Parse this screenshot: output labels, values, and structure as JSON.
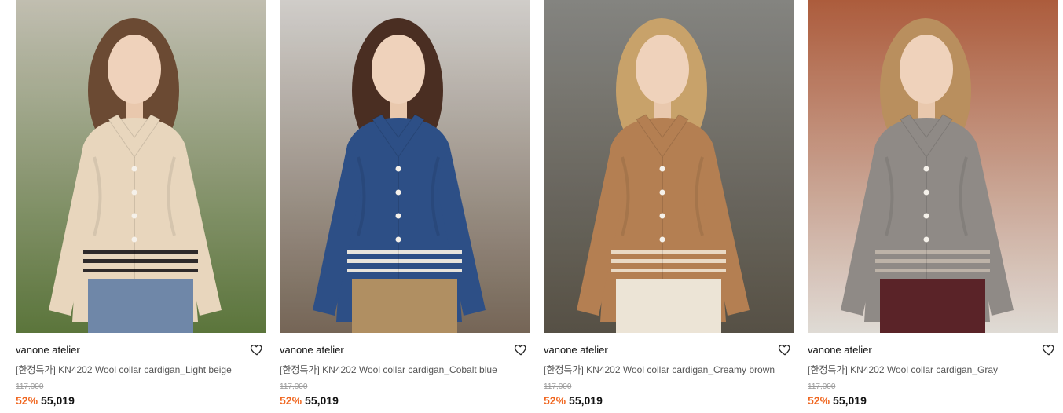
{
  "products": [
    {
      "brand": "vanone atelier",
      "title": "[한정특가] KN4202 Wool collar cardigan_Light beige",
      "original_price": "117,000",
      "discount": "52%",
      "price": "55,019",
      "wishlist_icon": "heart-outline-icon",
      "colors": {
        "bg_top": "#c9c6b8",
        "bg_bottom": "#5f7a3e",
        "garment": "#e8d6bd",
        "stripe": "#2e2a2a",
        "hair": "#6b4a33",
        "pants": "#6f87a8"
      }
    },
    {
      "brand": "vanone atelier",
      "title": "[한정특가] KN4202 Wool collar cardigan_Cobalt blue",
      "original_price": "117,000",
      "discount": "52%",
      "price": "55,019",
      "wishlist_icon": "heart-outline-icon",
      "colors": {
        "bg_top": "#d9d6d2",
        "bg_bottom": "#7a6a5a",
        "garment": "#2d4f86",
        "stripe": "#e8e4dc",
        "hair": "#4a2e22",
        "pants": "#b08f62"
      }
    },
    {
      "brand": "vanone atelier",
      "title": "[한정특가] KN4202 Wool collar cardigan_Creamy brown",
      "original_price": "117,000",
      "discount": "52%",
      "price": "55,019",
      "wishlist_icon": "heart-outline-icon",
      "colors": {
        "bg_top": "#8a8a86",
        "bg_bottom": "#5a5448",
        "garment": "#b47f52",
        "stripe": "#ead9c4",
        "hair": "#c8a26a",
        "pants": "#ece4d6"
      }
    },
    {
      "brand": "vanone atelier",
      "title": "[한정특가] KN4202 Wool collar cardigan_Gray",
      "original_price": "117,000",
      "discount": "52%",
      "price": "55,019",
      "wishlist_icon": "heart-outline-icon",
      "colors": {
        "bg_top": "#b4603f",
        "bg_bottom": "#e9e4de",
        "garment": "#8f8a86",
        "stripe": "#bdb3a8",
        "hair": "#b98f5e",
        "pants": "#5a2328"
      }
    }
  ]
}
